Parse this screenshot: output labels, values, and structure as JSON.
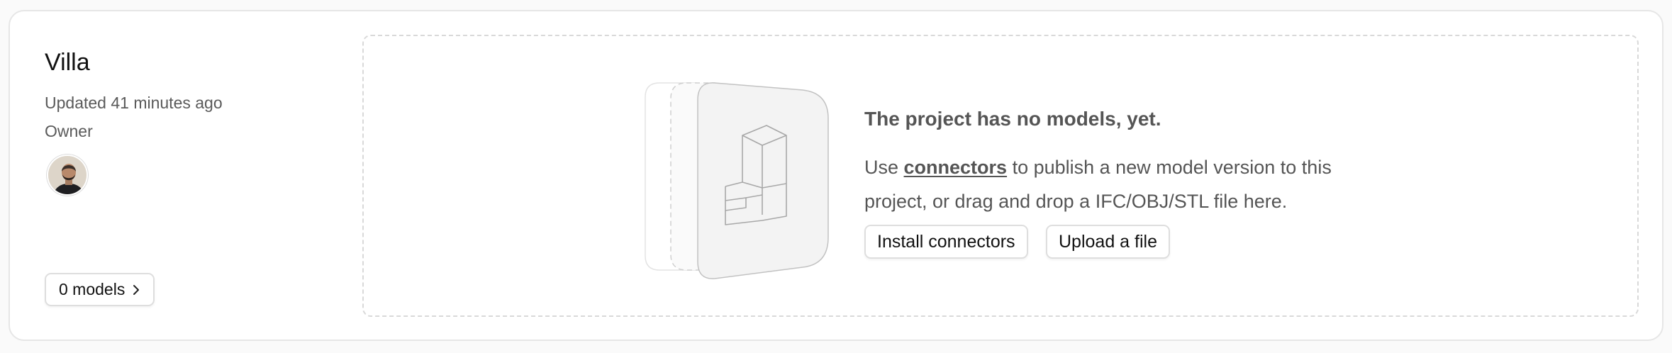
{
  "project": {
    "name": "Villa",
    "updated": "Updated 41 minutes ago",
    "role": "Owner",
    "models_label": "0 models"
  },
  "empty_state": {
    "title": "The project has no models, yet.",
    "desc_prefix": "Use ",
    "desc_link": "connectors",
    "desc_suffix": " to publish a new model version to this project, or drag and drop a IFC/OBJ/STL file here.",
    "install_label": "Install connectors",
    "upload_label": "Upload a file"
  },
  "icons": {
    "models_chevron": "chevron-right-icon",
    "illustration": "building-model-icon"
  },
  "colors": {
    "text_primary": "#111111",
    "text_secondary": "#555555",
    "border": "#dedede"
  }
}
